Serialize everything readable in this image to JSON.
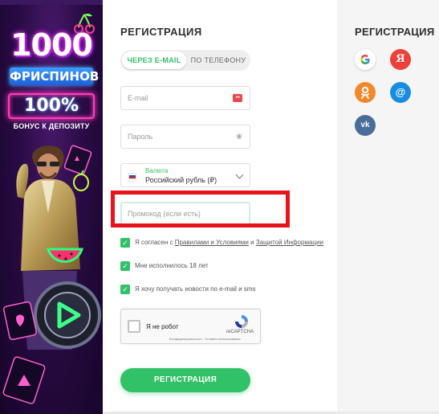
{
  "promo": {
    "amount": "1000",
    "freespins": "ФРИСПИНОВ",
    "percent": "100%",
    "bonus": "БОНУС К ДЕПОЗИТУ"
  },
  "form": {
    "title": "РЕГИСТРАЦИЯ",
    "tabs": [
      {
        "label": "ЧЕРЕЗ E-MAIL",
        "active": true
      },
      {
        "label": "ПО ТЕЛЕФОНУ",
        "active": false
      }
    ],
    "email_placeholder": "E-mail",
    "password_placeholder": "Пароль",
    "currency": {
      "caption": "Валюта",
      "value": "Российский рубль (₽)"
    },
    "promo_placeholder": "Промокод (если есть)",
    "checks": {
      "terms_prefix": "Я согласен с ",
      "terms_link": "Правилами и Условиями",
      "terms_and": " и ",
      "privacy_link": "Защитой Информации",
      "age": "Мне исполнилось 18 лет",
      "news": "Я хочу получать новости по e-mail и sms"
    },
    "captcha": {
      "label": "Я не робот",
      "brand": "reCAPTCHA",
      "terms": "Конфиденциальность - Условия использования"
    },
    "submit": "РЕГИСТРАЦИЯ"
  },
  "social": {
    "title": "РЕГИСТРАЦИЯ",
    "google": "G",
    "yandex": "Я",
    "ok": "ok",
    "mail": "@",
    "vk": "vk"
  },
  "colors": {
    "accent_green": "#31c166",
    "highlight_red": "#e8141b"
  }
}
